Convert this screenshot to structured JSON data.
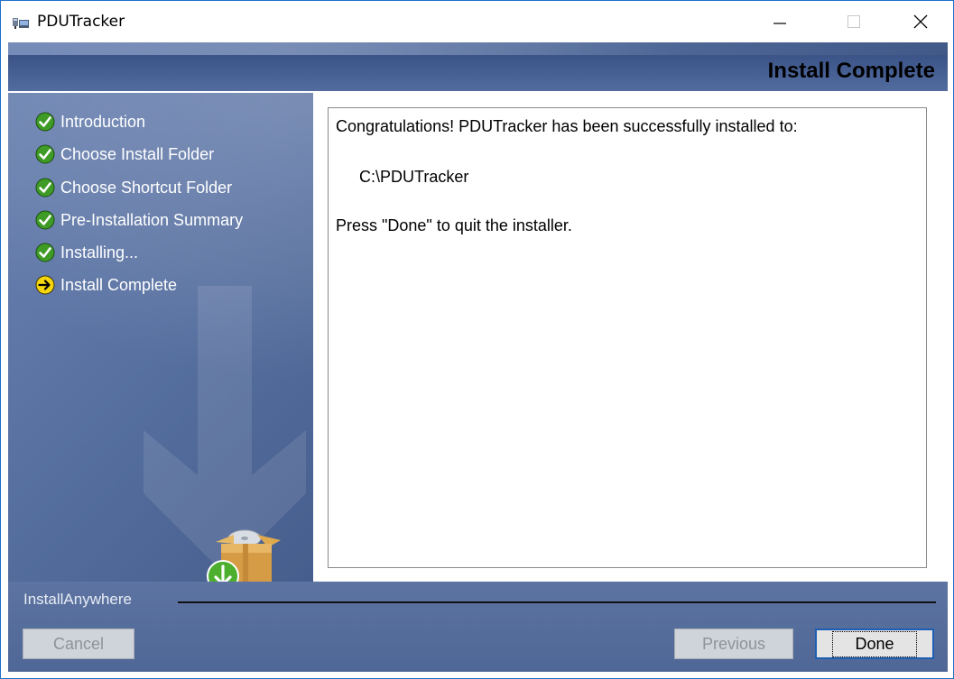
{
  "window": {
    "title": "PDUTracker",
    "icon": "app-icon",
    "controls": [
      "minimize-icon",
      "maximize-icon",
      "close-icon"
    ]
  },
  "header": {
    "title": "Install Complete"
  },
  "steps": [
    {
      "label": "Introduction",
      "status": "done",
      "icon": "check-icon"
    },
    {
      "label": "Choose Install Folder",
      "status": "done",
      "icon": "check-icon"
    },
    {
      "label": "Choose Shortcut Folder",
      "status": "done",
      "icon": "check-icon"
    },
    {
      "label": "Pre-Installation Summary",
      "status": "done",
      "icon": "check-icon"
    },
    {
      "label": "Installing...",
      "status": "done",
      "icon": "check-icon"
    },
    {
      "label": "Install Complete",
      "status": "current",
      "icon": "arrow-right-icon"
    }
  ],
  "content": {
    "message": "Congratulations! PDUTracker has been successfully installed to:",
    "path": "C:\\PDUTracker",
    "instruction": "Press \"Done\" to quit the installer."
  },
  "footer": {
    "brand": "InstallAnywhere",
    "cancel_label": "Cancel",
    "previous_label": "Previous",
    "done_label": "Done"
  },
  "colors": {
    "accent": "#1e5fb4",
    "check": "#3e9b25",
    "current_step": "#f3d60e",
    "panel": "#4f6796"
  }
}
